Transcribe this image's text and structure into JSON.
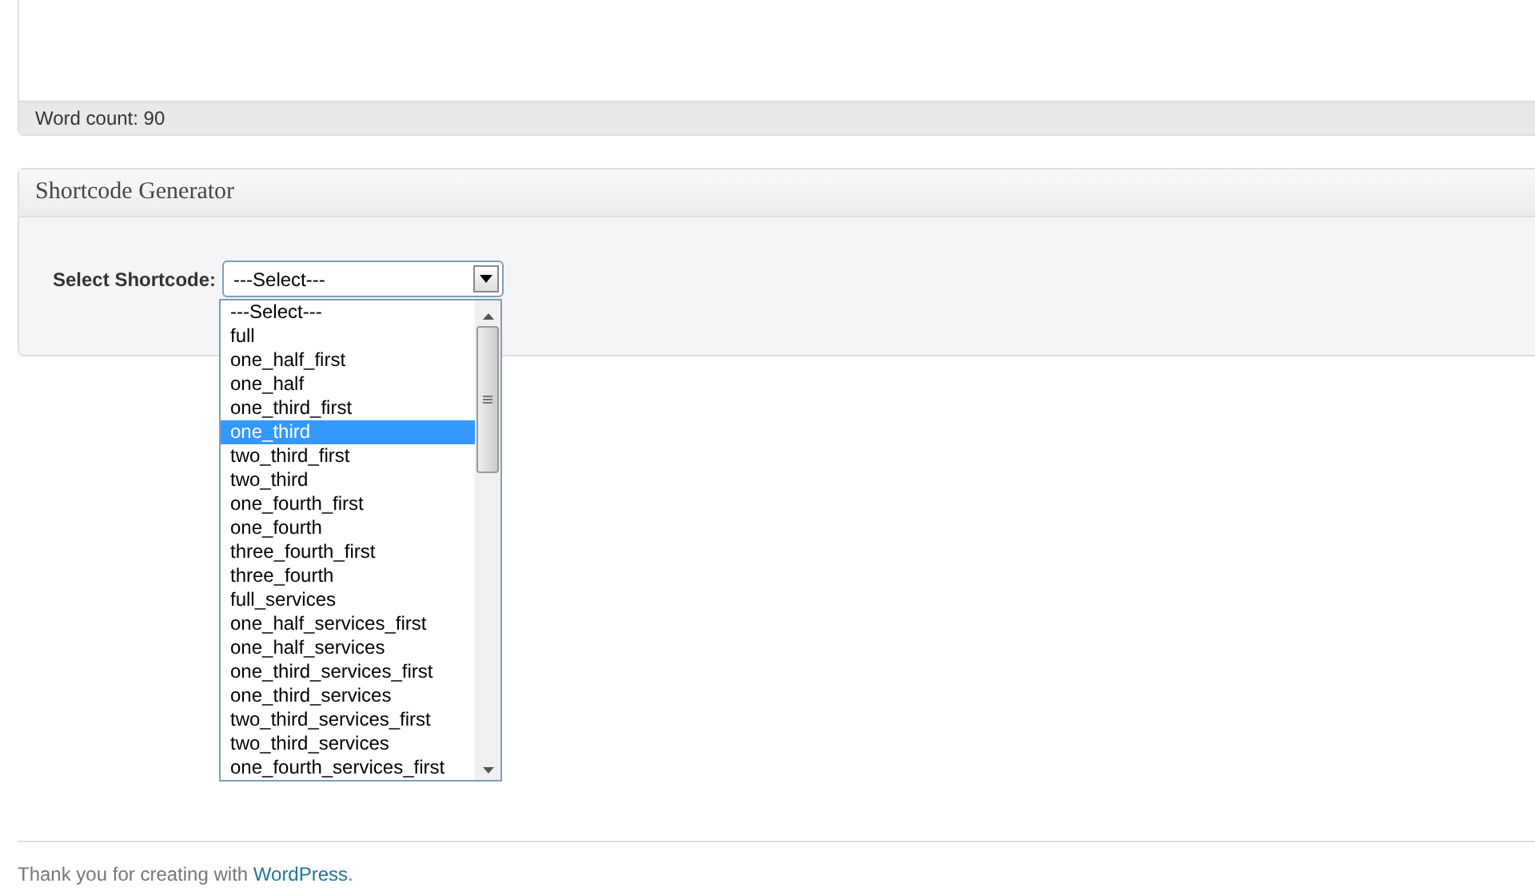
{
  "editor": {
    "word_count": "Word count: 90"
  },
  "shortcode_generator": {
    "title": "Shortcode Generator",
    "label": "Select Shortcode:",
    "value": "---Select---",
    "dropdown": {
      "expanded": true,
      "options": [
        {
          "label": "---Select---",
          "selected": false
        },
        {
          "label": "full",
          "selected": false
        },
        {
          "label": "one_half_first",
          "selected": false
        },
        {
          "label": "one_half",
          "selected": false
        },
        {
          "label": "one_third_first",
          "selected": false
        },
        {
          "label": "one_third",
          "selected": true
        },
        {
          "label": "two_third_first",
          "selected": false
        },
        {
          "label": "two_third",
          "selected": false
        },
        {
          "label": "one_fourth_first",
          "selected": false
        },
        {
          "label": "one_fourth",
          "selected": false
        },
        {
          "label": "three_fourth_first",
          "selected": false
        },
        {
          "label": "three_fourth",
          "selected": false
        },
        {
          "label": "full_services",
          "selected": false
        },
        {
          "label": "one_half_services_first",
          "selected": false
        },
        {
          "label": "one_half_services",
          "selected": false
        },
        {
          "label": "one_third_services_first",
          "selected": false
        },
        {
          "label": "one_third_services",
          "selected": false
        },
        {
          "label": "two_third_services_first",
          "selected": false
        },
        {
          "label": "two_third_services",
          "selected": false
        },
        {
          "label": "one_fourth_services_first",
          "selected": false
        }
      ]
    }
  },
  "footer": {
    "text": "Thank you for creating with ",
    "link": "WordPress",
    "after": "."
  }
}
